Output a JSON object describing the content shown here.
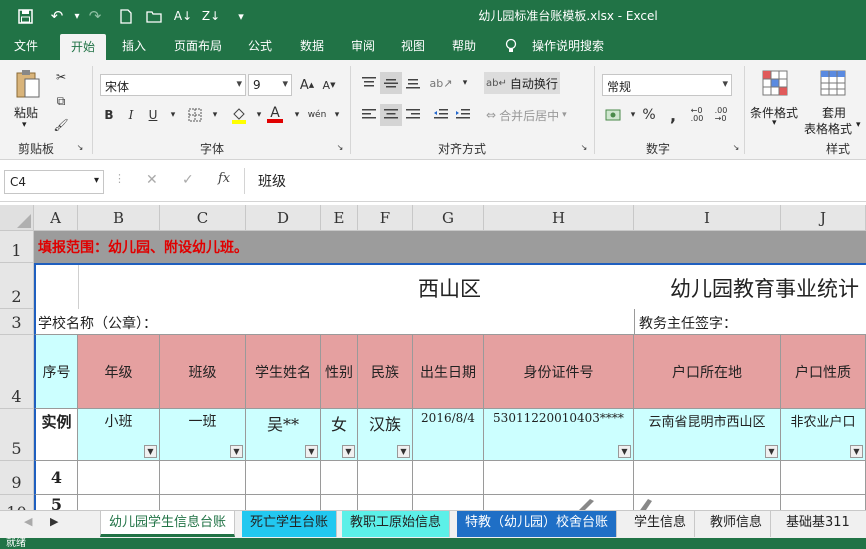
{
  "window": {
    "title": "幼儿园标准台账模板.xlsx  -  Excel"
  },
  "menu": [
    "文件",
    "开始",
    "插入",
    "页面布局",
    "公式",
    "数据",
    "审阅",
    "视图",
    "帮助",
    "操作说明搜索"
  ],
  "ribbon": {
    "paste": "粘贴",
    "clipboard": "剪贴板",
    "font_group": "字体",
    "align_group": "对齐方式",
    "number_group": "数字",
    "style_group": "样式",
    "font_name": "宋体",
    "font_size": "9",
    "bold": "B",
    "italic": "I",
    "underline": "U",
    "wrap": "自动换行",
    "merge": "合并后居中",
    "number_format": "常规",
    "cond_format": "条件格式",
    "table_format_1": "套用",
    "table_format_2": "表格格式"
  },
  "formula_bar": {
    "name_box": "C4",
    "content": "班级"
  },
  "columns": [
    "A",
    "B",
    "C",
    "D",
    "E",
    "F",
    "G",
    "H",
    "I",
    "J"
  ],
  "rows": [
    "1",
    "2",
    "3",
    "4",
    "5",
    "9",
    "10"
  ],
  "sheet": {
    "r1": "填报范围：幼儿园、附设幼儿班。",
    "r2_left": "西山区",
    "r2_right": "幼儿园教育事业统计",
    "r3_left": "学校名称（公章）：",
    "r3_right": "教务主任签字：",
    "headers": [
      "序号",
      "年级",
      "班级",
      "学生姓名",
      "性别",
      "民族",
      "出生日期",
      "身份证件号",
      "户口所在地",
      "户口性质"
    ],
    "example": [
      "实例",
      "小班",
      "一班",
      "吴**",
      "女",
      "汉族",
      "2016/8/4",
      "53011220010403****",
      "云南省昆明市西山区",
      "非农业户口"
    ],
    "r9": "4",
    "r10": "5"
  },
  "sheet_tabs": [
    "幼儿园学生信息台账",
    "死亡学生台账",
    "教职工原始信息",
    "特教（幼儿园）校舍台账",
    "学生信息",
    "教师信息",
    "基础基311"
  ],
  "status": "就绪"
}
